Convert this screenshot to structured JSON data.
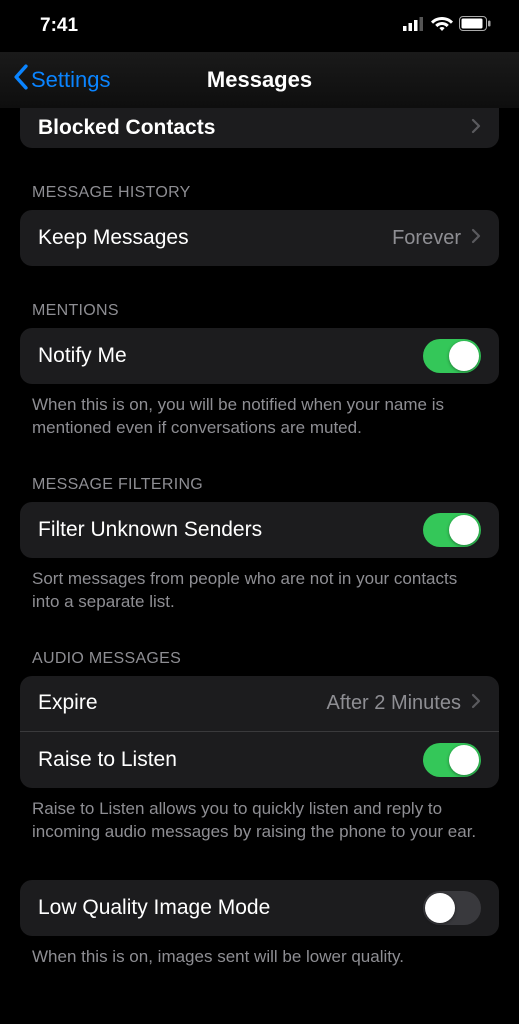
{
  "status": {
    "time": "7:41"
  },
  "nav": {
    "back": "Settings",
    "title": "Messages"
  },
  "top": {
    "blocked": "Blocked Contacts"
  },
  "history": {
    "header": "MESSAGE HISTORY",
    "keep": "Keep Messages",
    "keep_value": "Forever"
  },
  "mentions": {
    "header": "MENTIONS",
    "notify": "Notify Me",
    "footer": "When this is on, you will be notified when your name is mentioned even if conversations are muted."
  },
  "filtering": {
    "header": "MESSAGE FILTERING",
    "filter": "Filter Unknown Senders",
    "footer": "Sort messages from people who are not in your contacts into a separate list."
  },
  "audio": {
    "header": "AUDIO MESSAGES",
    "expire": "Expire",
    "expire_value": "After 2 Minutes",
    "raise": "Raise to Listen",
    "footer": "Raise to Listen allows you to quickly listen and reply to incoming audio messages by raising the phone to your ear."
  },
  "lowq": {
    "label": "Low Quality Image Mode",
    "footer": "When this is on, images sent will be lower quality."
  }
}
